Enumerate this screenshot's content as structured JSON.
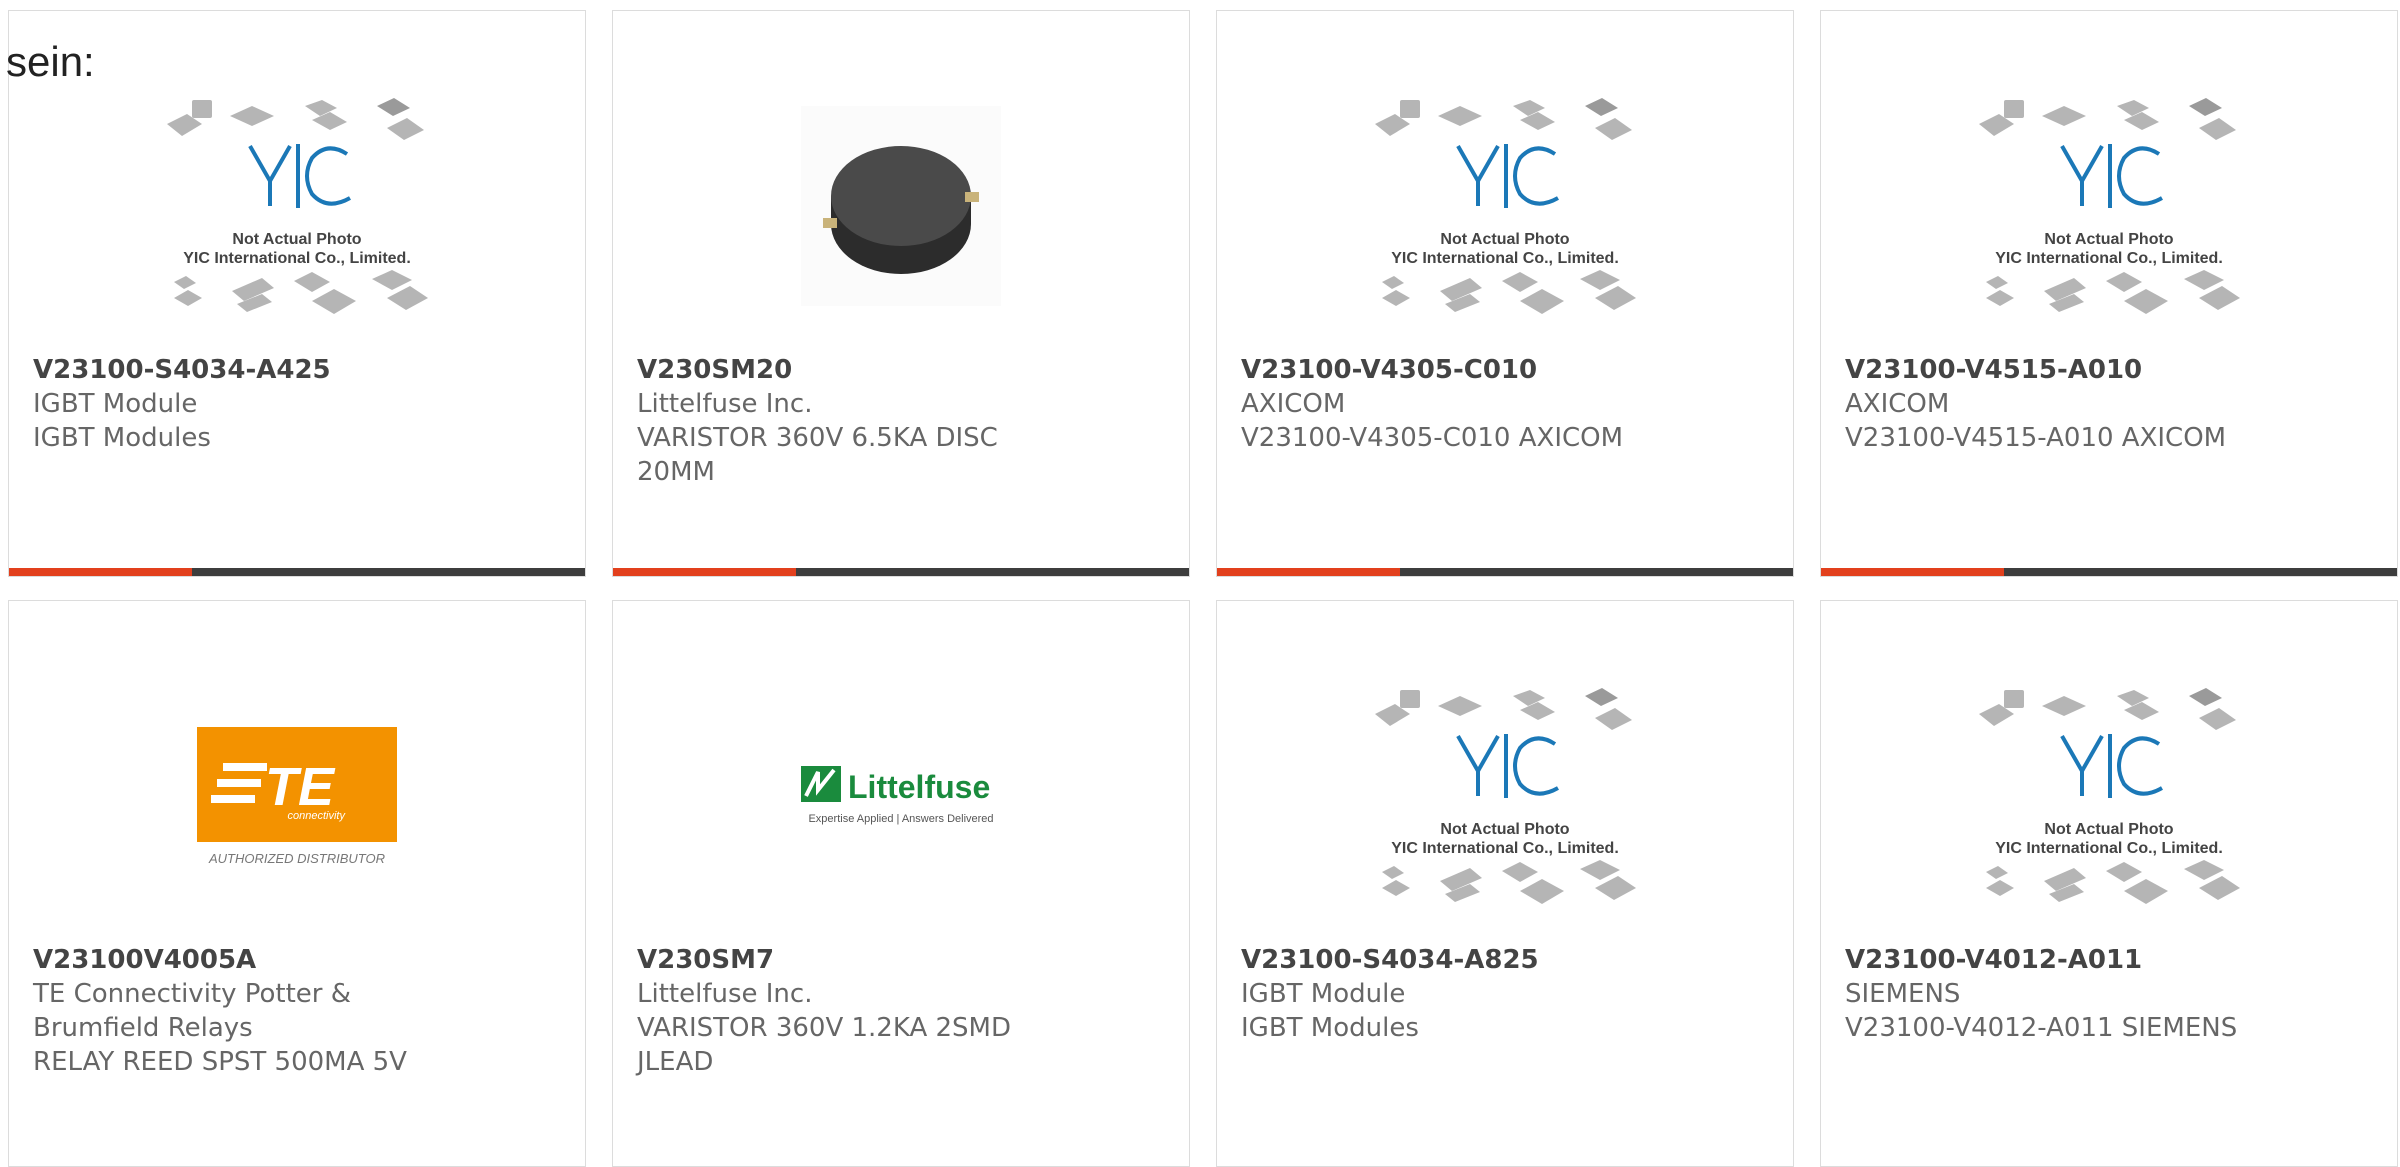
{
  "page": {
    "heading": "sein:"
  },
  "colors": {
    "accent": "#e2401d",
    "bar_dark": "#3d3d3d",
    "te_orange": "#f39200",
    "littelfuse_green": "#1a8b3d"
  },
  "placeholder": {
    "line1": "Not Actual Photo",
    "line2": "YIC International Co., Limited.",
    "brand": "YIC"
  },
  "logos": {
    "te": {
      "text": "TE",
      "sub": "connectivity",
      "caption": "AUTHORIZED DISTRIBUTOR"
    },
    "littelfuse": {
      "text": "Littelfuse",
      "tagline": "Expertise Applied | Answers Delivered"
    }
  },
  "products": [
    {
      "part_number": "V23100-S4034-A425",
      "lines": [
        "IGBT Module",
        "IGBT Modules"
      ],
      "image": "placeholder"
    },
    {
      "part_number": "V230SM20",
      "lines": [
        "Littelfuse Inc.",
        "VARISTOR 360V 6.5KA DISC",
        "20MM"
      ],
      "image": "varistor-disc"
    },
    {
      "part_number": "V23100-V4305-C010",
      "lines": [
        "AXICOM",
        "V23100-V4305-C010 AXICOM"
      ],
      "image": "placeholder"
    },
    {
      "part_number": "V23100-V4515-A010",
      "lines": [
        "AXICOM",
        "V23100-V4515-A010 AXICOM"
      ],
      "image": "placeholder"
    },
    {
      "part_number": "V23100V4005A",
      "lines": [
        "TE Connectivity Potter &",
        "Brumfield Relays",
        "RELAY REED SPST 500MA 5V"
      ],
      "image": "te-logo"
    },
    {
      "part_number": "V230SM7",
      "lines": [
        "Littelfuse Inc.",
        "VARISTOR 360V 1.2KA 2SMD",
        "JLEAD"
      ],
      "image": "littelfuse-logo"
    },
    {
      "part_number": "V23100-S4034-A825",
      "lines": [
        "IGBT Module",
        "IGBT Modules"
      ],
      "image": "placeholder"
    },
    {
      "part_number": "V23100-V4012-A011",
      "lines": [
        "SIEMENS",
        "V23100-V4012-A011 SIEMENS"
      ],
      "image": "placeholder"
    }
  ]
}
